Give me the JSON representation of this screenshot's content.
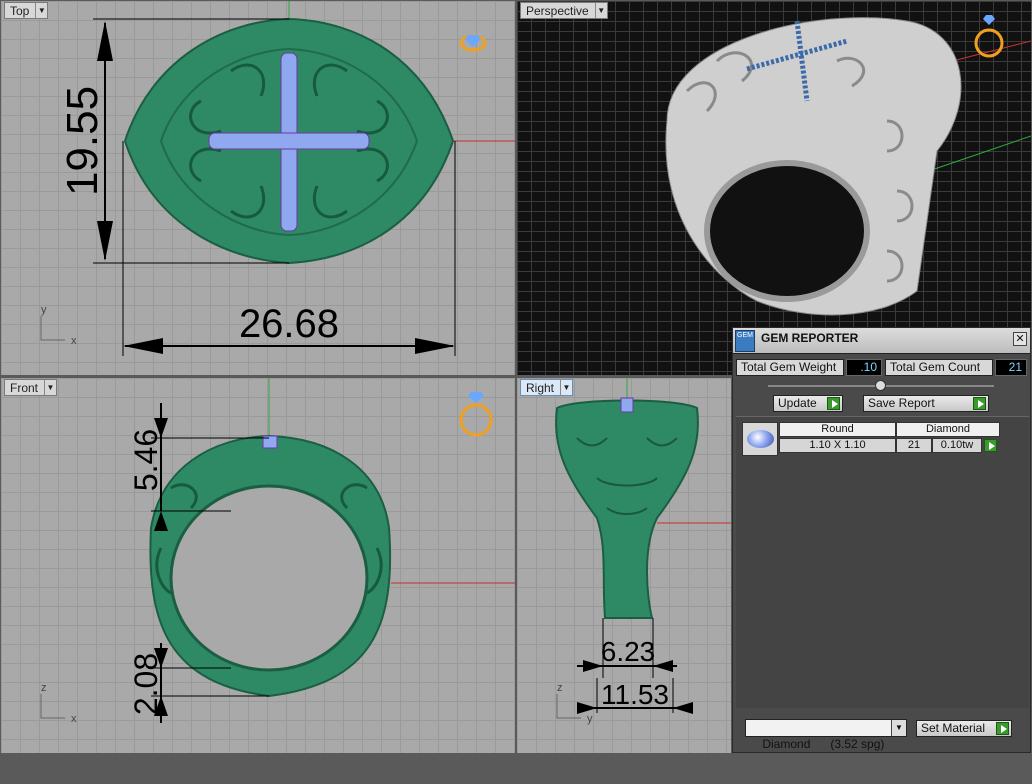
{
  "viewports": {
    "top": {
      "label": "Top",
      "dim_height": "19.55",
      "dim_width": "26.68",
      "axis_y": "y",
      "axis_x": "x"
    },
    "perspective": {
      "label": "Perspective"
    },
    "front": {
      "label": "Front",
      "dim_top": "5.46",
      "dim_bottom": "2.08",
      "axis_z": "z",
      "axis_x": "x"
    },
    "right": {
      "label": "Right",
      "dim_inner": "6.23",
      "dim_outer": "11.53",
      "axis_z": "z",
      "axis_y": "y"
    }
  },
  "gem_reporter": {
    "title": "GEM REPORTER",
    "logo_text": "GEM",
    "close": "✕",
    "total_weight_label": "Total Gem Weight",
    "total_weight_value": ".10",
    "total_count_label": "Total Gem Count",
    "total_count_value": "21",
    "update_label": "Update",
    "save_report_label": "Save Report",
    "table": {
      "header": [
        "Round",
        "Diamond"
      ],
      "row": {
        "size": "1.10 X 1.10",
        "count": "21",
        "weight": "0.10tw"
      }
    },
    "material_select": "Diamond      (3.52 spg)",
    "set_material_label": "Set Material"
  },
  "colors": {
    "ring_green": "#2e8a64",
    "ring_dark": "#1b5e44",
    "gem_blue": "#8fa8f0",
    "panel_bg": "#4a4a4a",
    "axis_red": "#c23030",
    "axis_green": "#2ea83a"
  }
}
